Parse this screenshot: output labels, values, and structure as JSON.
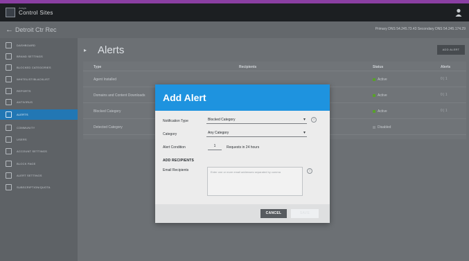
{
  "app": {
    "title": "Control Sites",
    "subtitle": "Ansys",
    "site_name": "Detroit Ctr Rec",
    "dns_info": "Primary DNS 54.245.73.43  Secondary DNS 54.245.174.29"
  },
  "sidebar": {
    "items": [
      {
        "label": "DASHBOARD",
        "icon": "dashboard-icon"
      },
      {
        "label": "BRAND SETTINGS",
        "icon": "brand-icon"
      },
      {
        "label": "BLOCKED CATEGORIES",
        "icon": "block-icon"
      },
      {
        "label": "WHITELIST/BLACKLIST",
        "icon": "list-icon"
      },
      {
        "label": "REPORTS",
        "icon": "reports-icon"
      },
      {
        "label": "ANTIVIRUS",
        "icon": "shield-icon"
      },
      {
        "label": "ALERTS",
        "icon": "bell-icon",
        "active": true
      },
      {
        "label": "COMMUNITY",
        "icon": "download-icon"
      },
      {
        "label": "USERS",
        "icon": "users-icon"
      },
      {
        "label": "ACCOUNT SETTINGS",
        "icon": "settings-icon"
      },
      {
        "label": "BLOCK PAGE",
        "icon": "page-icon"
      },
      {
        "label": "ALERT SETTINGS",
        "icon": "gear-icon"
      },
      {
        "label": "SUBSCRIPTION/QUOTA",
        "icon": "billing-icon"
      }
    ]
  },
  "main": {
    "title": "Alerts",
    "add_button": "ADD ALERT",
    "columns": [
      "Type",
      "Recipients",
      "Status",
      "Alerts"
    ],
    "rows": [
      {
        "type": "Agent Installed",
        "status": "Active",
        "status_color": "#58a02a",
        "edit": "0 | 1"
      },
      {
        "type": "Domains and Content Downloads",
        "status": "Active",
        "status_color": "#58a02a",
        "edit": "0 | 1"
      },
      {
        "type": "Blocked Category",
        "status": "Active",
        "status_color": "#58a02a",
        "edit": "0 | 1"
      },
      {
        "type": "Detected Category",
        "status": "Disabled",
        "status_color": "#8a8e92",
        "edit": ""
      }
    ]
  },
  "modal": {
    "title": "Add Alert",
    "notification_type_label": "Notification Type",
    "notification_type_value": "Blocked Category",
    "category_label": "Category",
    "category_value": "Any Category",
    "alert_condition_label": "Alert Condition",
    "alert_condition_value": "1",
    "alert_condition_suffix": "Requests in 24 hours",
    "section_title": "ADD RECIPIENTS",
    "email_label": "Email Recipients",
    "email_placeholder": "Enter one or more email addresses separated by comma",
    "cancel_label": "CANCEL",
    "save_label": "SAVE"
  },
  "colors": {
    "accent": "#1e93df",
    "sidebar_active": "#2277b4",
    "topbar": "#1c1f22",
    "brand_strip": "#8a3fa3"
  }
}
